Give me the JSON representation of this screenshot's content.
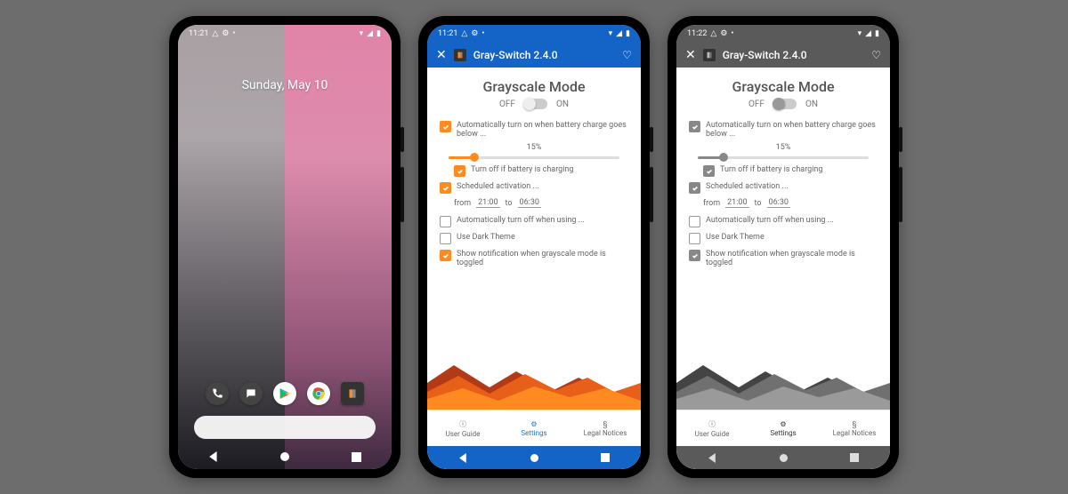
{
  "phones": {
    "home": {
      "status_time": "11:21",
      "date": "Sunday, May 10",
      "dock_apps": [
        "phone",
        "messages",
        "play-store",
        "chrome",
        "gray-switch"
      ]
    },
    "color": {
      "status_time": "11:21",
      "app_title": "Gray-Switch 2.4.0",
      "heading": "Grayscale Mode",
      "off_label": "OFF",
      "on_label": "ON",
      "opt_battery": "Automatically turn on when battery charge goes below ...",
      "battery_pct": "15%",
      "opt_charging": "Turn off if battery is charging",
      "opt_schedule": "Scheduled activation ...",
      "sched_from": "from",
      "sched_t1": "21:00",
      "sched_to": "to",
      "sched_t2": "06:30",
      "opt_autooff": "Automatically turn off when using ...",
      "opt_darktheme": "Use Dark Theme",
      "opt_notif": "Show notification when grayscale mode is toggled",
      "nav_guide": "User Guide",
      "nav_settings": "Settings",
      "nav_legal": "Legal Notices"
    },
    "gray": {
      "status_time": "11:22",
      "app_title": "Gray-Switch 2.4.0",
      "heading": "Grayscale Mode",
      "off_label": "OFF",
      "on_label": "ON",
      "opt_battery": "Automatically turn on when battery charge goes below ...",
      "battery_pct": "15%",
      "opt_charging": "Turn off if battery is charging",
      "opt_schedule": "Scheduled activation ...",
      "sched_from": "from",
      "sched_t1": "21:00",
      "sched_to": "to",
      "sched_t2": "06:30",
      "opt_autooff": "Automatically turn off when using ...",
      "opt_darktheme": "Use Dark Theme",
      "opt_notif": "Show notification when grayscale mode is toggled",
      "nav_guide": "User Guide",
      "nav_settings": "Settings",
      "nav_legal": "Legal Notices"
    }
  }
}
